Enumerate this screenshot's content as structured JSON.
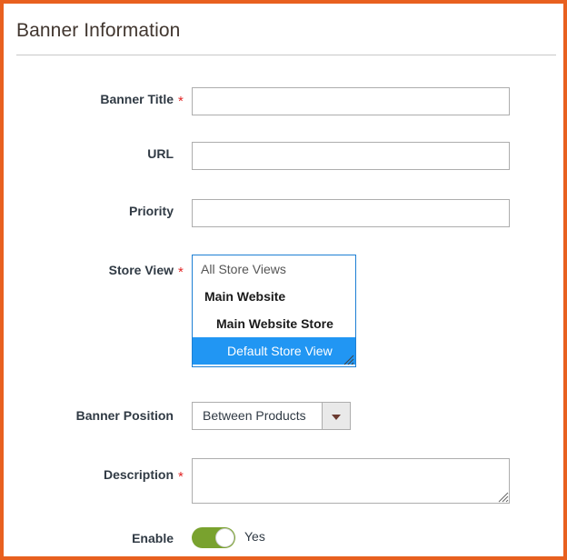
{
  "panel": {
    "accent_border_color": "#e8601f",
    "background_color": "#ffffff",
    "title": "Banner Information"
  },
  "form": {
    "required_marker": "*",
    "fields": [
      {
        "name": "banner_title",
        "label": "Banner Title",
        "required": true,
        "type": "text",
        "value": "",
        "placeholder": ""
      },
      {
        "name": "url",
        "label": "URL",
        "required": false,
        "type": "text",
        "value": "",
        "placeholder": ""
      },
      {
        "name": "priority",
        "label": "Priority",
        "required": false,
        "type": "text",
        "value": "",
        "placeholder": ""
      },
      {
        "name": "store_view",
        "label": "Store View",
        "required": true,
        "type": "multiselect"
      },
      {
        "name": "banner_position",
        "label": "Banner Position",
        "required": false,
        "type": "select"
      },
      {
        "name": "description",
        "label": "Description",
        "required": true,
        "type": "textarea",
        "value": "",
        "placeholder": ""
      },
      {
        "name": "enable",
        "label": "Enable",
        "required": false,
        "type": "toggle"
      }
    ]
  },
  "store_view": {
    "options": [
      {
        "label": "All Store Views",
        "level": "all",
        "selected": false
      },
      {
        "label": "Main Website",
        "level": "website",
        "selected": false
      },
      {
        "label": "Main Website Store",
        "level": "group",
        "selected": false
      },
      {
        "label": "Default Store View",
        "level": "view",
        "selected": true
      }
    ],
    "selected_highlight_color": "#2196f3",
    "focus_border_color": "#1d7fd4",
    "resize_handle_icon": "resize-grip-icon"
  },
  "banner_position": {
    "selected": "Between Products",
    "arrow_icon": "chevron-down-icon"
  },
  "enable": {
    "state": "on",
    "state_label": "Yes",
    "on_color": "#79a22e"
  }
}
